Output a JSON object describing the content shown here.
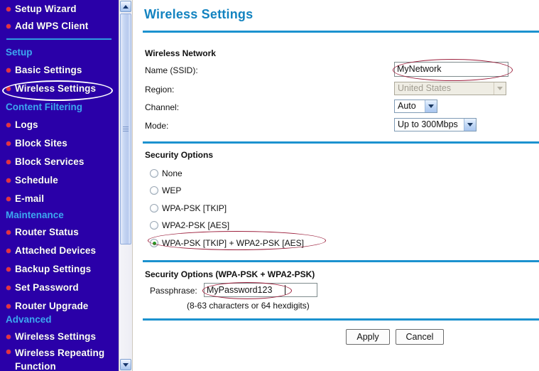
{
  "sidebar": {
    "top_items": [
      {
        "label": "Setup Wizard"
      },
      {
        "label": "Add WPS Client"
      }
    ],
    "groups": [
      {
        "heading": "Setup",
        "items": [
          {
            "label": "Basic Settings"
          },
          {
            "label": "Wireless Settings",
            "selected": true
          }
        ]
      },
      {
        "heading": "Content Filtering",
        "items": [
          {
            "label": "Logs"
          },
          {
            "label": "Block Sites"
          },
          {
            "label": "Block Services"
          },
          {
            "label": "Schedule"
          },
          {
            "label": "E-mail"
          }
        ]
      },
      {
        "heading": "Maintenance",
        "items": [
          {
            "label": "Router Status"
          },
          {
            "label": "Attached Devices"
          },
          {
            "label": "Backup Settings"
          },
          {
            "label": "Set Password"
          },
          {
            "label": "Router Upgrade"
          }
        ]
      },
      {
        "heading": "Advanced",
        "items": [
          {
            "label": "Wireless Settings"
          },
          {
            "label": "Wireless Repeating Function"
          }
        ]
      }
    ]
  },
  "scrollbar": {
    "up_arrow": "scroll-up-arrow",
    "down_arrow": "scroll-down-arrow"
  },
  "main": {
    "page_title": "Wireless Settings",
    "wireless_network": {
      "section_title": "Wireless Network",
      "ssid_label": "Name (SSID):",
      "ssid_value": "MyNetwork",
      "region_label": "Region:",
      "region_value": "United States",
      "channel_label": "Channel:",
      "channel_value": "Auto",
      "mode_label": "Mode:",
      "mode_value": "Up to 300Mbps"
    },
    "security_options": {
      "section_title": "Security Options",
      "options": [
        {
          "label": "None",
          "selected": false
        },
        {
          "label": "WEP",
          "selected": false
        },
        {
          "label": "WPA-PSK [TKIP]",
          "selected": false
        },
        {
          "label": "WPA2-PSK [AES]",
          "selected": false
        },
        {
          "label": "WPA-PSK [TKIP] + WPA2-PSK [AES]",
          "selected": true
        }
      ]
    },
    "psk_section": {
      "section_title": "Security Options (WPA-PSK + WPA2-PSK)",
      "passphrase_label": "Passphrase:",
      "passphrase_value": "MyPassword123",
      "hint": "(8-63 characters or 64 hexdigits)"
    },
    "buttons": {
      "apply": "Apply",
      "cancel": "Cancel"
    }
  },
  "colors": {
    "sidebar_bg": "#2A00A8",
    "sidebar_heading": "#3CA8F0",
    "sidebar_bullet": "#E8323C",
    "title_blue": "#1383C0",
    "rule_blue": "#1C92CF",
    "annotation_red": "#9C1F3C",
    "radio_selected": "#1E9E23"
  }
}
